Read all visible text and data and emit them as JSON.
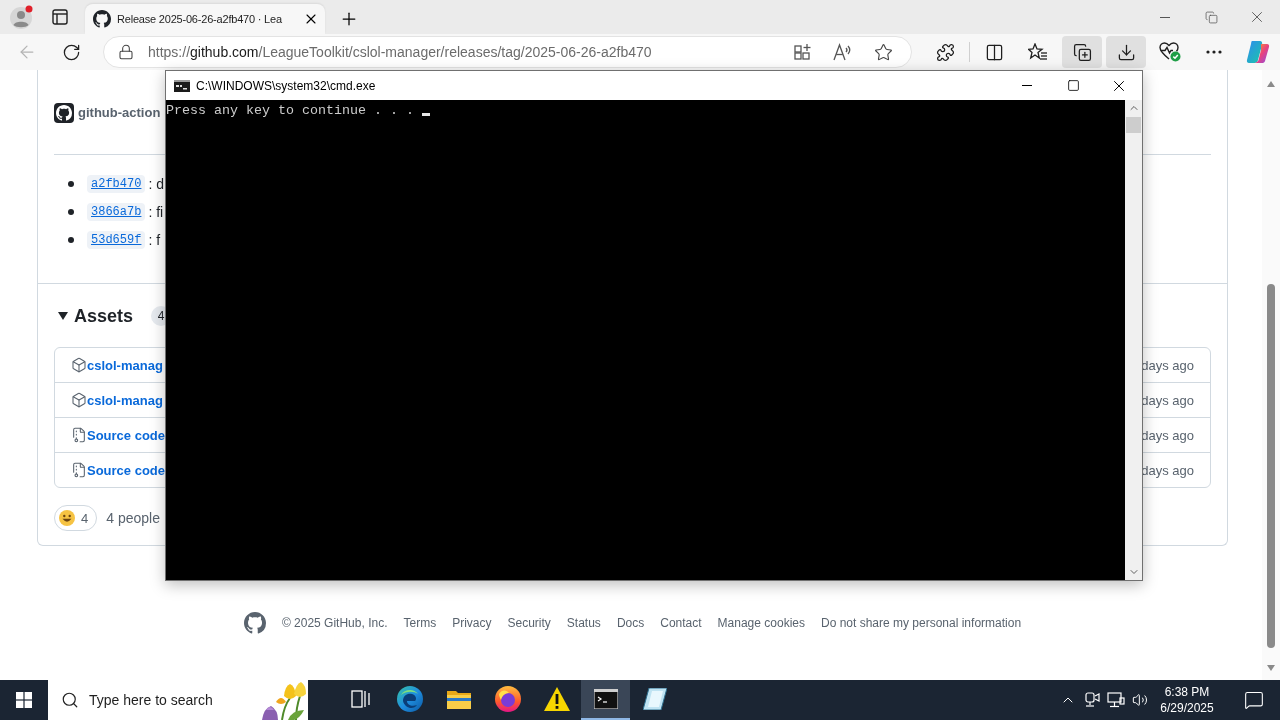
{
  "browser": {
    "tabs": [
      {
        "title": "Release 2025-06-26-a2fb470 · Lea",
        "selected": true
      }
    ],
    "nav_buttons": [
      {
        "kind": "back",
        "disabled": true
      },
      {
        "kind": "refresh",
        "disabled": false
      }
    ],
    "address": {
      "scheme": "https://",
      "host": "github.com",
      "path": "/LeagueToolkit/cslol-manager/releases/tag/2025-06-26-a2fb470"
    },
    "toolbar_buttons": [
      {
        "kind": "extensions",
        "pressed": false
      },
      {
        "kind": "split_screen",
        "pressed": false
      },
      {
        "kind": "favorites",
        "pressed": false
      },
      {
        "kind": "collections",
        "pressed": true
      },
      {
        "kind": "downloads",
        "pressed": true
      },
      {
        "kind": "essentials",
        "pressed": false
      },
      {
        "kind": "more",
        "pressed": false
      },
      {
        "kind": "copilot",
        "pressed": false
      }
    ]
  },
  "page": {
    "author": "github-action",
    "commits": [
      {
        "sha": "a2fb470",
        "text": ": d"
      },
      {
        "sha": "3866a7b",
        "text": ": fi"
      },
      {
        "sha": "53d659f",
        "text": ": f"
      }
    ],
    "assets": {
      "title": "Assets",
      "expanded": true,
      "count": "4",
      "files": [
        {
          "kind": "package",
          "name": "cslol-manag",
          "age": "days ago"
        },
        {
          "kind": "package",
          "name": "cslol-manag",
          "age": "days ago"
        },
        {
          "kind": "archive",
          "name": "Source code",
          "age": "days ago"
        },
        {
          "kind": "archive",
          "name": "Source code",
          "age": "days ago"
        }
      ]
    },
    "reactions": {
      "count": "4",
      "summary": "4 people"
    },
    "footer": {
      "copyright": "© 2025 GitHub, Inc.",
      "links": [
        "Terms",
        "Privacy",
        "Security",
        "Status",
        "Docs",
        "Contact",
        "Manage cookies",
        "Do not share my personal information"
      ]
    }
  },
  "cmd_window": {
    "title": "C:\\WINDOWS\\system32\\cmd.exe",
    "output": "Press any key to continue . . ."
  },
  "taskbar": {
    "search_placeholder": "Type here to search",
    "apps": [
      {
        "kind": "task_view",
        "active": false
      },
      {
        "kind": "edge",
        "active": false
      },
      {
        "kind": "explorer",
        "active": false
      },
      {
        "kind": "firefox",
        "active": false
      },
      {
        "kind": "warning",
        "active": false
      },
      {
        "kind": "terminal",
        "active": true
      },
      {
        "kind": "sheet",
        "active": false
      }
    ],
    "time": "6:38 PM",
    "date": "6/29/2025"
  }
}
